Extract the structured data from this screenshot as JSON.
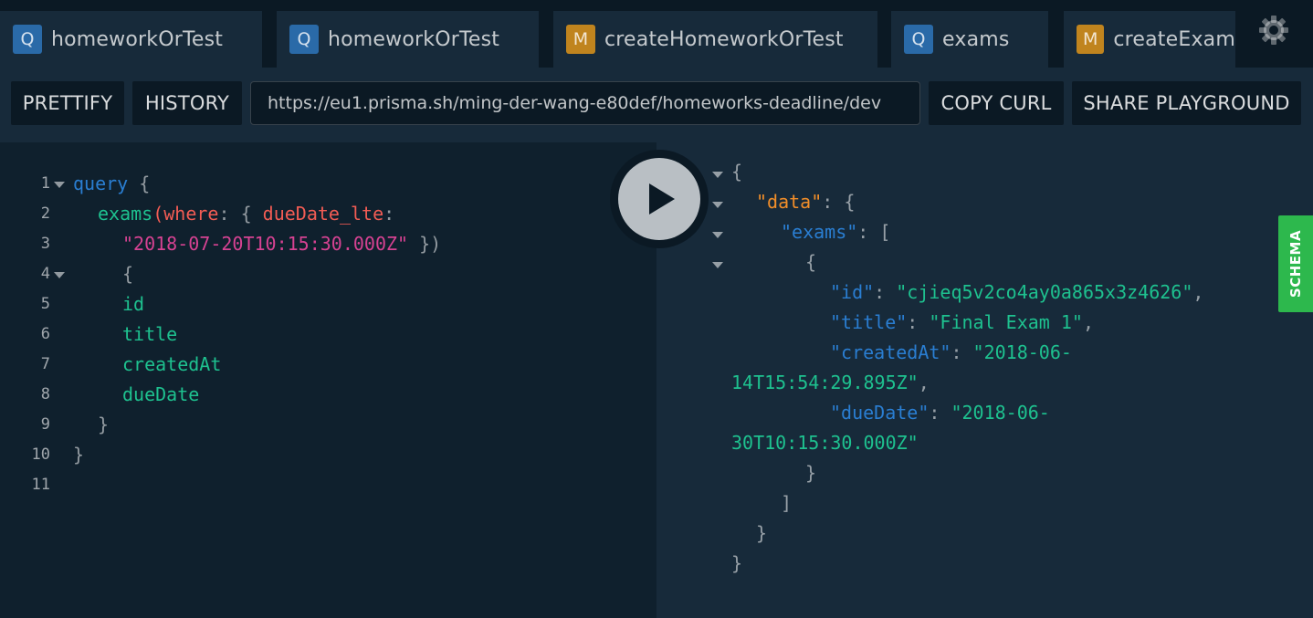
{
  "tabs": [
    {
      "badge": "Q",
      "type": "query",
      "label": "homeworkOrTest"
    },
    {
      "badge": "Q",
      "type": "query",
      "label": "homeworkOrTest"
    },
    {
      "badge": "M",
      "type": "mutation",
      "label": "createHomeworkOrTest"
    },
    {
      "badge": "Q",
      "type": "query",
      "label": "exams"
    },
    {
      "badge": "M",
      "type": "mutation",
      "label": "createExam"
    }
  ],
  "toolbar": {
    "prettify_label": "PRETTIFY",
    "history_label": "HISTORY",
    "endpoint_url": "https://eu1.prisma.sh/ming-der-wang-e80def/homeworks-deadline/dev",
    "copy_curl_label": "COPY CURL",
    "share_label": "SHARE PLAYGROUND"
  },
  "editor": {
    "line_numbers": [
      "1",
      "2",
      "3",
      "4",
      "5",
      "6",
      "7",
      "8",
      "9",
      "10",
      "11"
    ],
    "tokens": {
      "query_kw": "query",
      "open_brace": "{",
      "exams": "exams",
      "paren_open": "(",
      "where": "where",
      "colon_brace": ": { ",
      "due_arg": "dueDate_lte",
      "colon": ":",
      "date_value": "\"2018-07-20T10:15:30.000Z\"",
      "close_args": " })",
      "sel_open": "{",
      "f_id": "id",
      "f_title": "title",
      "f_createdAt": "createdAt",
      "f_dueDate": "dueDate",
      "sel_close": "}",
      "query_close": "}"
    }
  },
  "result": {
    "open": "{",
    "data_key": "\"data\"",
    "colon_brace": ": {",
    "exams_key": "\"exams\"",
    "colon_bracket": ": [",
    "item_open": "{",
    "id_key": "\"id\"",
    "id_val": "\"cjieq5v2co4ay0a865x3z4626\"",
    "title_key": "\"title\"",
    "title_val": "\"Final Exam 1\"",
    "createdAt_key": "\"createdAt\"",
    "createdAt_val_a": "\"2018-06-",
    "createdAt_val_b": "14T15:54:29.895Z\"",
    "dueDate_key": "\"dueDate\"",
    "dueDate_val_a": "\"2018-06-",
    "dueDate_val_b": "30T10:15:30.000Z\"",
    "item_close": "}",
    "array_close": "]",
    "data_close": "}",
    "root_close": "}",
    "sep": ": ",
    "comma": ","
  },
  "schema_label": "SCHEMA",
  "colors": {
    "query_badge": "#2a6aa8",
    "mutation_badge": "#c0841e",
    "schema_tab": "#2db84d",
    "keyword": "#2a7ed2",
    "field": "#1ec18f",
    "argument": "#f25c54",
    "string_arg": "#d64292",
    "data_key": "#f28e29"
  },
  "icons": [
    "settings-gear-icon",
    "reload-icon",
    "play-icon",
    "fold-arrow-icon"
  ]
}
